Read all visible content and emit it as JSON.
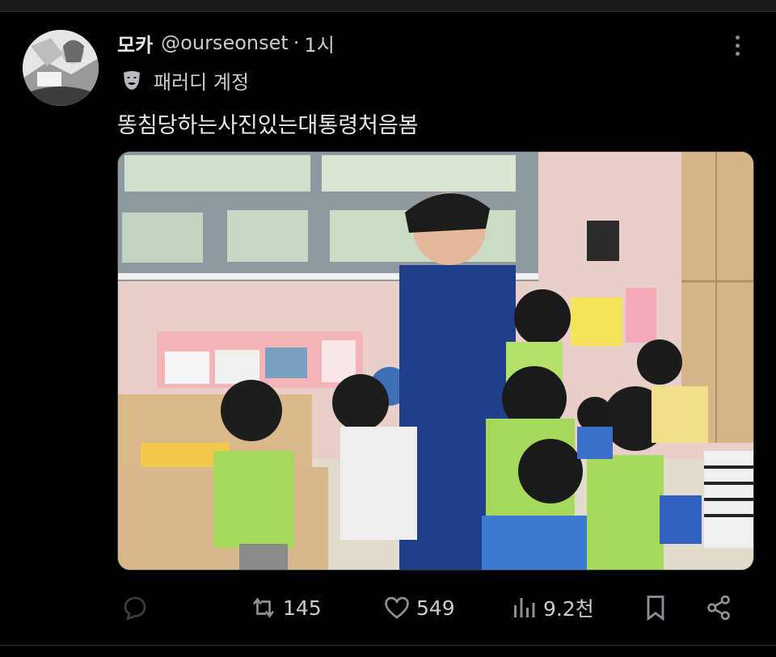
{
  "tweet": {
    "author_name": "모카",
    "handle": "@ourseonset",
    "separator": "·",
    "time": "1시",
    "label_icon": "parody-mask-icon",
    "account_label": "패러디 계정",
    "text": "똥침당하는사진있는대통령처음봄"
  },
  "actions": {
    "reply": {
      "icon": "reply-icon",
      "count": ""
    },
    "repost": {
      "icon": "repost-icon",
      "count": "145"
    },
    "like": {
      "icon": "heart-icon",
      "count": "549"
    },
    "views": {
      "icon": "views-icon",
      "count": "9.2천"
    },
    "bookmark": {
      "icon": "bookmark-icon"
    },
    "share": {
      "icon": "share-icon"
    }
  },
  "colors": {
    "background": "#000000",
    "text_primary": "#e7e9ea",
    "text_secondary": "#c9ccd0",
    "icon_gray": "#8b9096"
  }
}
